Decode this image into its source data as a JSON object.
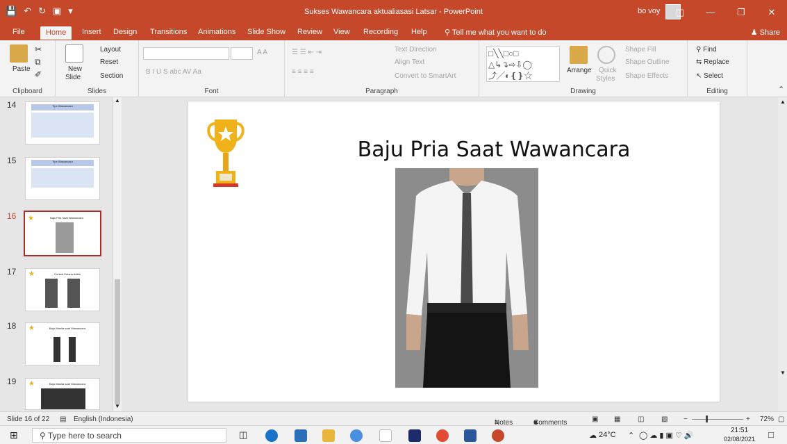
{
  "app": {
    "doc_title": "Sukses Wawancara aktualiasasi Latsar - PowerPoint",
    "user": "bo voy",
    "share_label": "Share",
    "tell_me": "Tell me what you want to do",
    "colors": {
      "accent": "#c6482a",
      "ribbon": "#f3f3f3"
    }
  },
  "tabs": [
    "File",
    "Home",
    "Insert",
    "Design",
    "Transitions",
    "Animations",
    "Slide Show",
    "Review",
    "View",
    "Recording",
    "Help"
  ],
  "ribbon": {
    "clipboard": {
      "paste": "Paste",
      "label": "Clipboard"
    },
    "slides": {
      "new_slide": "New",
      "new_slide2": "Slide",
      "layout": "Layout",
      "reset": "Reset",
      "section": "Section",
      "label": "Slides"
    },
    "font": {
      "label": "Font",
      "format_letters": "B  I  U  S  abc  AV  Aa",
      "size_letters": "A  A"
    },
    "paragraph": {
      "text_direction": "Text Direction",
      "align_text": "Align Text",
      "smartart": "Convert to SmartArt",
      "label": "Paragraph"
    },
    "drawing": {
      "arrange": "Arrange",
      "quick_styles": "Quick",
      "quick_styles2": "Styles",
      "shape_fill": "Shape Fill",
      "shape_outline": "Shape Outline",
      "shape_effects": "Shape Effects",
      "label": "Drawing"
    },
    "editing": {
      "find": "Find",
      "replace": "Replace",
      "select": "Select",
      "label": "Editing"
    }
  },
  "thumbnails": [
    {
      "number": "14",
      "title": "Tipe Wawancara"
    },
    {
      "number": "15",
      "title": "Tipe Wawancara"
    },
    {
      "number": "16",
      "title": "Baju Pria Saat Wawancara"
    },
    {
      "number": "17",
      "title": "Contoh Celana Aktifa"
    },
    {
      "number": "18",
      "title": "Baju Wanita saat Wawancara"
    },
    {
      "number": "19",
      "title": "Baju Wanita saat Wawancara"
    }
  ],
  "slide": {
    "title": "Baju Pria Saat Wawancara"
  },
  "status": {
    "slide_counter": "Slide 16 of 22",
    "language": "English (Indonesia)",
    "notes": "Notes",
    "comments": "Comments",
    "zoom": "72%"
  },
  "taskbar": {
    "search_placeholder": "Type here to search",
    "temperature": "24°C",
    "time": "21:51",
    "date": "02/08/2021"
  }
}
